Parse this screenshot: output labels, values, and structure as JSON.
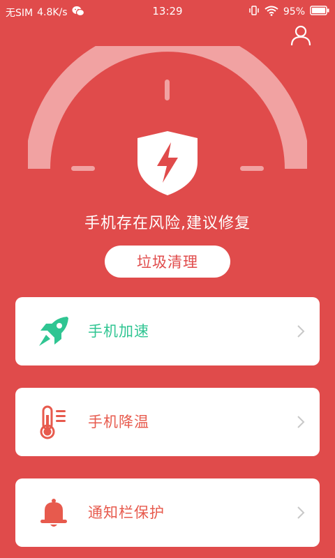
{
  "status_bar": {
    "carrier": "无SIM",
    "speed": "4.8K/s",
    "time": "13:29",
    "battery": "95%"
  },
  "hero": {
    "message": "手机存在风险,建议修复",
    "action_label": "垃圾清理"
  },
  "cards": [
    {
      "label": "手机加速",
      "icon": "rocket-icon",
      "color": "#2fc592"
    },
    {
      "label": "手机降温",
      "icon": "thermometer-icon",
      "color": "#e75a4d"
    },
    {
      "label": "通知栏保护",
      "icon": "bell-icon",
      "color": "#e75a4d"
    }
  ],
  "colors": {
    "background": "#e04b4b",
    "accent_green": "#2fc592",
    "accent_red": "#e75a4d",
    "card": "#ffffff"
  }
}
